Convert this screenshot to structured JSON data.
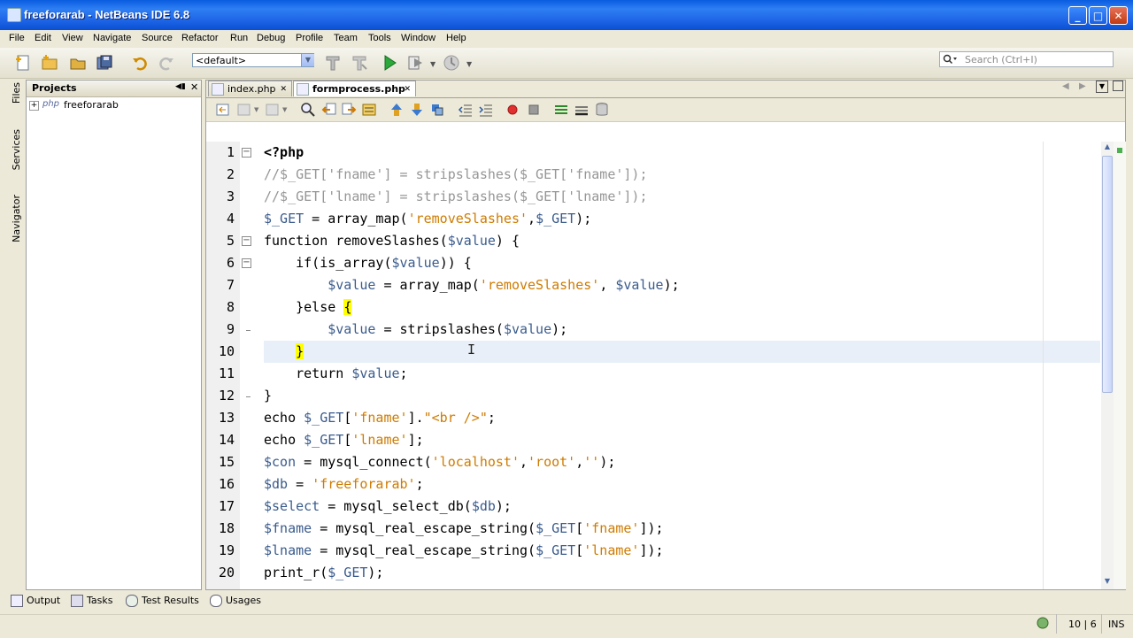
{
  "window": {
    "title": "freeforarab - NetBeans IDE 6.8"
  },
  "menubar": [
    "File",
    "Edit",
    "View",
    "Navigate",
    "Source",
    "Refactor",
    "Run",
    "Debug",
    "Profile",
    "Team",
    "Tools",
    "Window",
    "Help"
  ],
  "toolbar": {
    "config_value": "<default>",
    "search_placeholder": "Search (Ctrl+I)"
  },
  "left_strip": [
    "Files",
    "Services",
    "Navigator"
  ],
  "projects": {
    "title": "Projects",
    "tree": [
      {
        "badge": "php",
        "label": "freeforarab"
      }
    ]
  },
  "editor": {
    "tabs": [
      {
        "label": "index.php",
        "active": false
      },
      {
        "label": "formprocess.php",
        "active": true
      }
    ],
    "line_numbers": [
      "1",
      "2",
      "3",
      "4",
      "5",
      "6",
      "7",
      "8",
      "9",
      "10",
      "11",
      "12",
      "13",
      "14",
      "15",
      "16",
      "17",
      "18",
      "19",
      "20"
    ],
    "lines": [
      "<?php",
      "//$_GET['fname'] = stripslashes($_GET['fname']);",
      "//$_GET['lname'] = stripslashes($_GET['lname']);",
      "$_GET = array_map('removeSlashes',$_GET);",
      "function removeSlashes($value) {",
      "    if(is_array($value)) {",
      "        $value = array_map('removeSlashes', $value);",
      "    }else {",
      "        $value = stripslashes($value);",
      "    }",
      "    return $value;",
      "}",
      "echo $_GET['fname'].\"<br />\";",
      "echo $_GET['lname'];",
      "$con = mysql_connect('localhost','root','');",
      "$db = 'freeforarab';",
      "$select = mysql_select_db($db);",
      "$fname = mysql_real_escape_string($_GET['fname']);",
      "$lname = mysql_real_escape_string($_GET['lname']);",
      "print_r($_GET);"
    ]
  },
  "bottom_tabs": [
    "Output",
    "Tasks",
    "Test Results",
    "Usages"
  ],
  "status": {
    "position": "10 | 6",
    "mode": "INS"
  },
  "colors": {
    "titlebar": "#0a5ce0",
    "string": "#ce7b00",
    "comment": "#969696",
    "variable": "#3a5b8c",
    "brace_highlight": "#ffff00"
  }
}
